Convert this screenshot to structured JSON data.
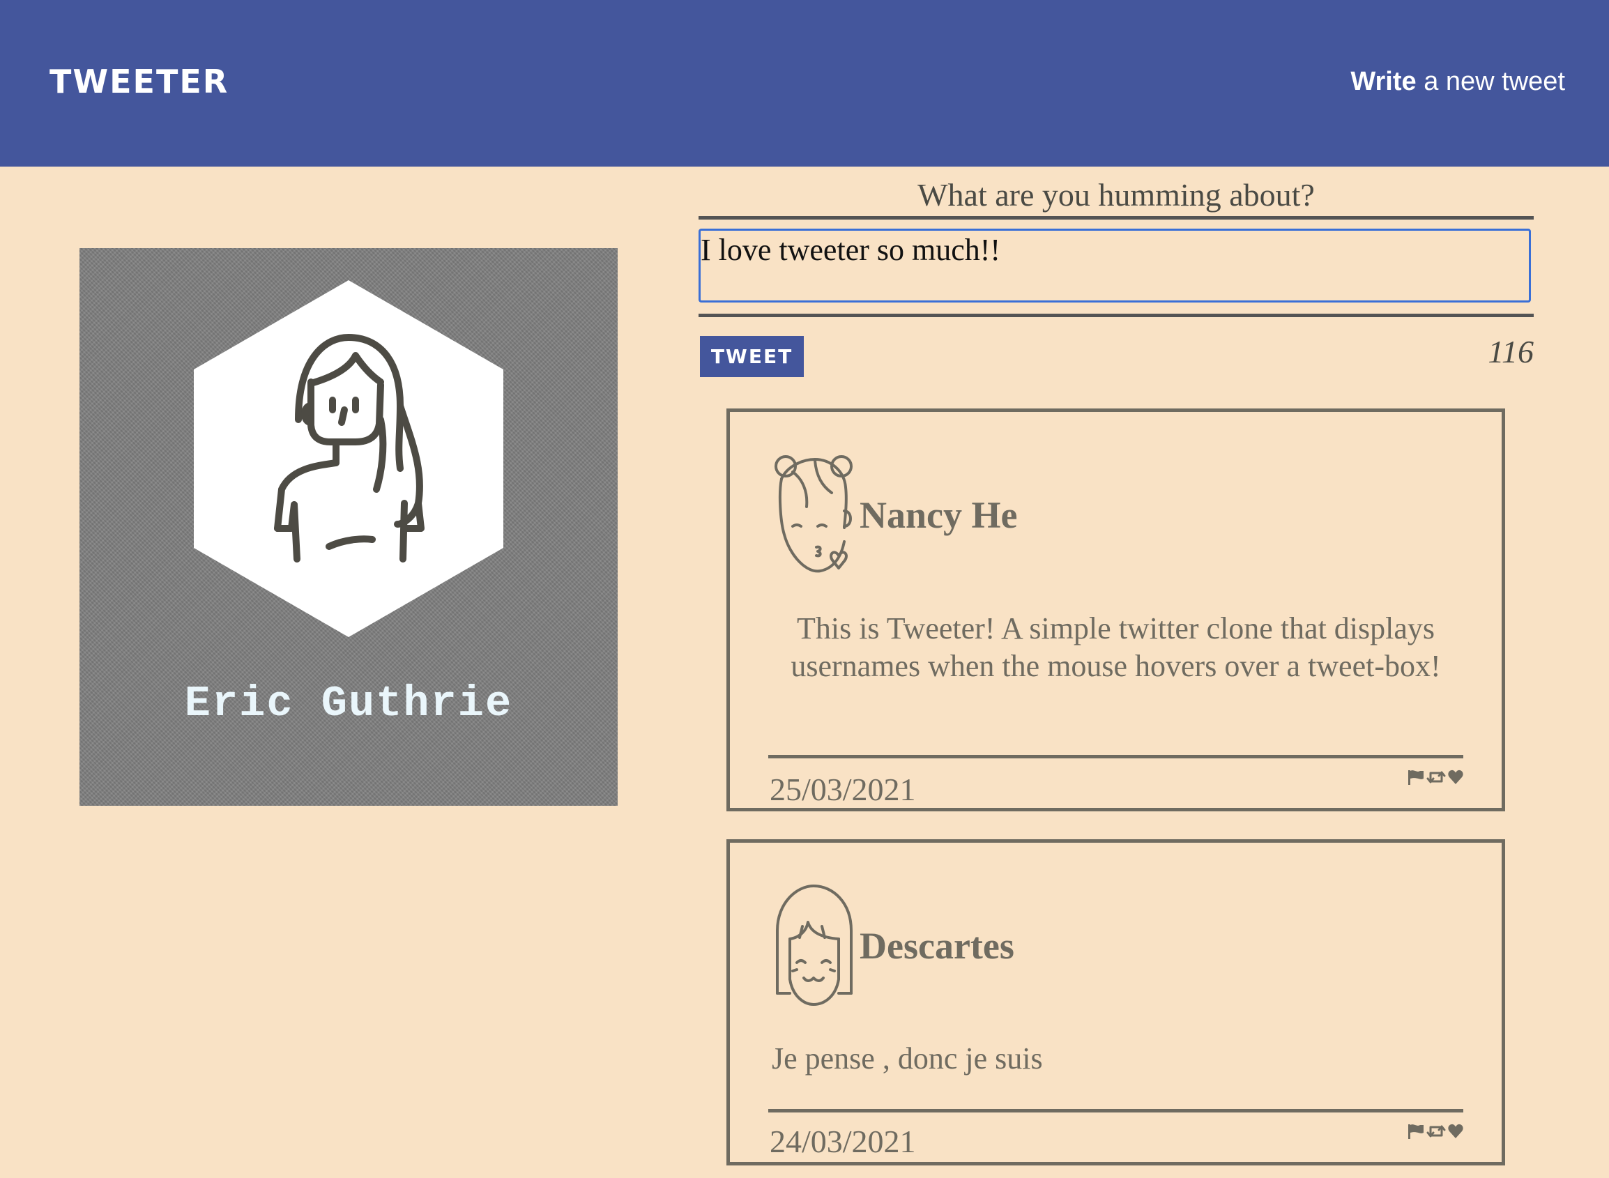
{
  "navbar": {
    "brand": "TWEETER",
    "write_strong": "Write",
    "write_rest": " a new tweet"
  },
  "profile": {
    "name": "Eric Guthrie",
    "avatar_icon": "woman-avatar-icon"
  },
  "compose": {
    "title": "What are you humming about?",
    "input_value": "I love tweeter so much!!",
    "button_label": "TWEET",
    "counter": "116"
  },
  "tweets": [
    {
      "author": "Nancy He",
      "avatar_icon": "girl-kiss-avatar-icon",
      "text": "This is Tweeter! A simple twitter clone that displays usernames when the mouse hovers over a tweet-box!",
      "date": "25/03/2021",
      "actions": [
        "flag-icon",
        "retweet-icon",
        "heart-icon"
      ]
    },
    {
      "author": "Descartes",
      "avatar_icon": "girl-smile-avatar-icon",
      "text": "Je pense , donc je suis",
      "date": "24/03/2021",
      "actions": [
        "flag-icon",
        "retweet-icon",
        "heart-icon"
      ]
    }
  ],
  "colors": {
    "navbar": "#44569c",
    "page_background": "#f9e2c5",
    "tweet_text": "#6f6b60",
    "profile_card": "#7f7f7f",
    "input_focus_border": "#3a6fd6"
  }
}
